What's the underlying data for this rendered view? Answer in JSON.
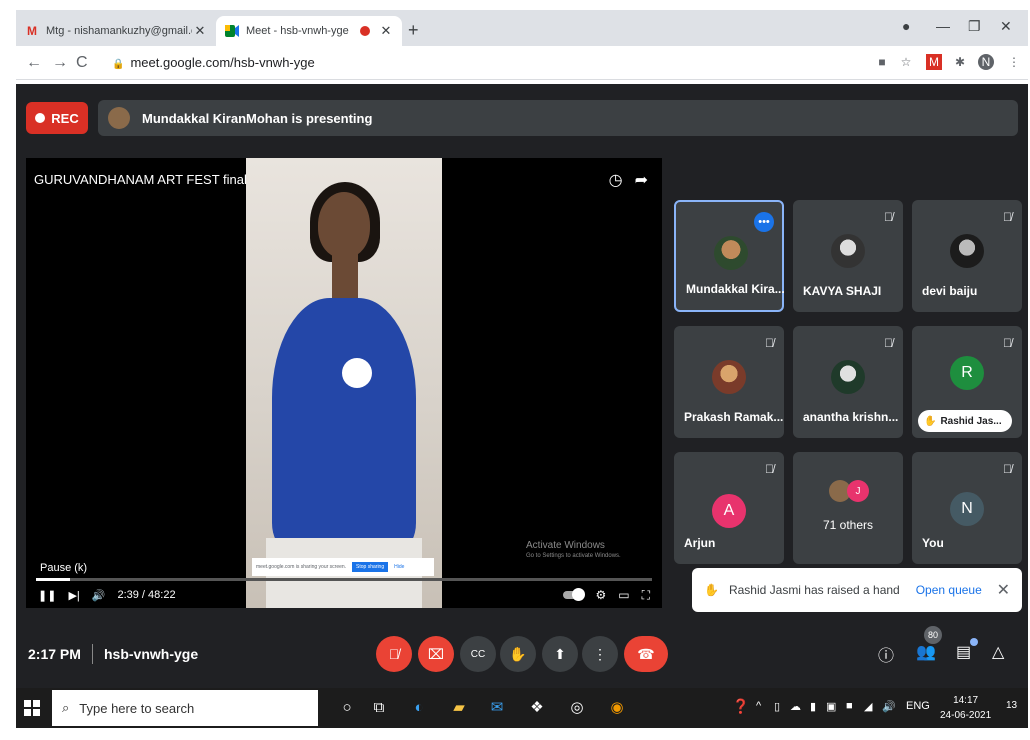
{
  "browser": {
    "tabs": [
      {
        "title": "Mtg - nishamankuzhy@gmail.co",
        "favicon": "gmail-icon"
      },
      {
        "title": "Meet - hsb-vnwh-yge",
        "favicon": "meet-icon",
        "recording": true
      }
    ],
    "new_tab": "+",
    "url": "meet.google.com/hsb-vnwh-yge",
    "profile_letter": "N"
  },
  "meet": {
    "rec_label": "REC",
    "presenting_text": "Mundakkal KiranMohan is presenting",
    "video": {
      "title": "GURUVANDHANAM ART FEST final",
      "pause_tooltip": "Pause (k)",
      "time": "2:39 / 48:22",
      "progress": 0.055,
      "share_text": "meet.google.com is sharing your screen.",
      "stop_sharing": "Stop sharing",
      "hide": "Hide",
      "activate_title": "Activate Windows",
      "activate_sub": "Go to Settings to activate Windows."
    },
    "tiles": [
      {
        "name": "Mundakkal Kira...",
        "avatar": "photo"
      },
      {
        "name": "KAVYA SHAJI",
        "avatar": "photo"
      },
      {
        "name": "devi baiju",
        "avatar": "photo"
      },
      {
        "name": "Prakash Ramak...",
        "avatar": "photo"
      },
      {
        "name": "anantha krishn...",
        "avatar": "photo"
      },
      {
        "name": "Rashid Jas...",
        "avatar_letter": "R"
      },
      {
        "name": "Arjun",
        "avatar_letter": "A"
      },
      {
        "name": "71 others",
        "avatar_letter": "J"
      },
      {
        "name": "You",
        "avatar_letter": "N"
      }
    ],
    "notification": {
      "text": "Rashid Jasmi has raised a hand",
      "action": "Open queue"
    },
    "bottom": {
      "time": "2:17 PM",
      "meeting_code": "hsb-vnwh-yge",
      "participant_count": "80"
    }
  },
  "taskbar": {
    "search_placeholder": "Type here to search",
    "lang": "ENG",
    "clock_time": "14:17",
    "clock_date": "24-06-2021",
    "notification_count": "13"
  }
}
